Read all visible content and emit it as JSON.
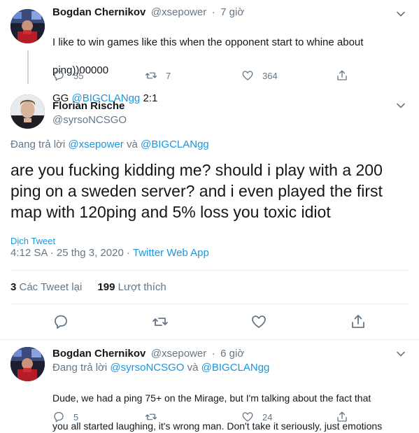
{
  "tweet1": {
    "name": "Bogdan Chernikov",
    "handle": "@xsepower",
    "dot": "·",
    "time": "7 giờ",
    "line1": "I like to win games like this when the opponent start to whine about",
    "line2": "ping))00000",
    "line3_prefix": "GG ",
    "line3_mention": "@BIGCLANgg",
    "line3_suffix": " 2:1",
    "replies": "55",
    "retweets": "7",
    "likes": "364",
    "icons": [
      "reply-icon",
      "retweet-icon",
      "like-icon",
      "share-icon"
    ]
  },
  "main_tweet": {
    "name": "Florian Rische",
    "handle": "@syrsoNCSGO",
    "reply_prefix": "Đang trả lời ",
    "reply_mention1": "@xsepower",
    "reply_and": " và ",
    "reply_mention2": "@BIGCLANgg",
    "text": "are you fucking kidding me? should i play with a 200 ping on a sweden server? and i even played the first map with 120ping and 5% loss you toxic idiot",
    "translate": "Dịch Tweet",
    "timestamp": "4:12 SA · 25 thg 3, 2020 · ",
    "source": "Twitter Web App",
    "retweet_count": "3",
    "retweet_label": " Các Tweet lại",
    "like_count": "199",
    "like_label": " Lượt thích"
  },
  "tweet3": {
    "name": "Bogdan Chernikov",
    "handle": "@xsepower",
    "dot": "·",
    "time": "6 giờ",
    "reply_prefix": "Đang trả lời ",
    "reply_mention1": "@syrsoNCSGO",
    "reply_and": " và ",
    "reply_mention2": "@BIGCLANgg",
    "line1": "Dude, we had a ping 75+ on the Mirage, but I'm talking about the fact that",
    "line2": "you all started laughing, it's wrong man. Don't take it seriously, just emotions",
    "replies": "5",
    "retweets": "",
    "likes": "24"
  },
  "colors": {
    "accent": "#1b95e0",
    "secondary_text": "#657786",
    "primary_text": "#14171a",
    "divider": "#e6ecf0"
  }
}
